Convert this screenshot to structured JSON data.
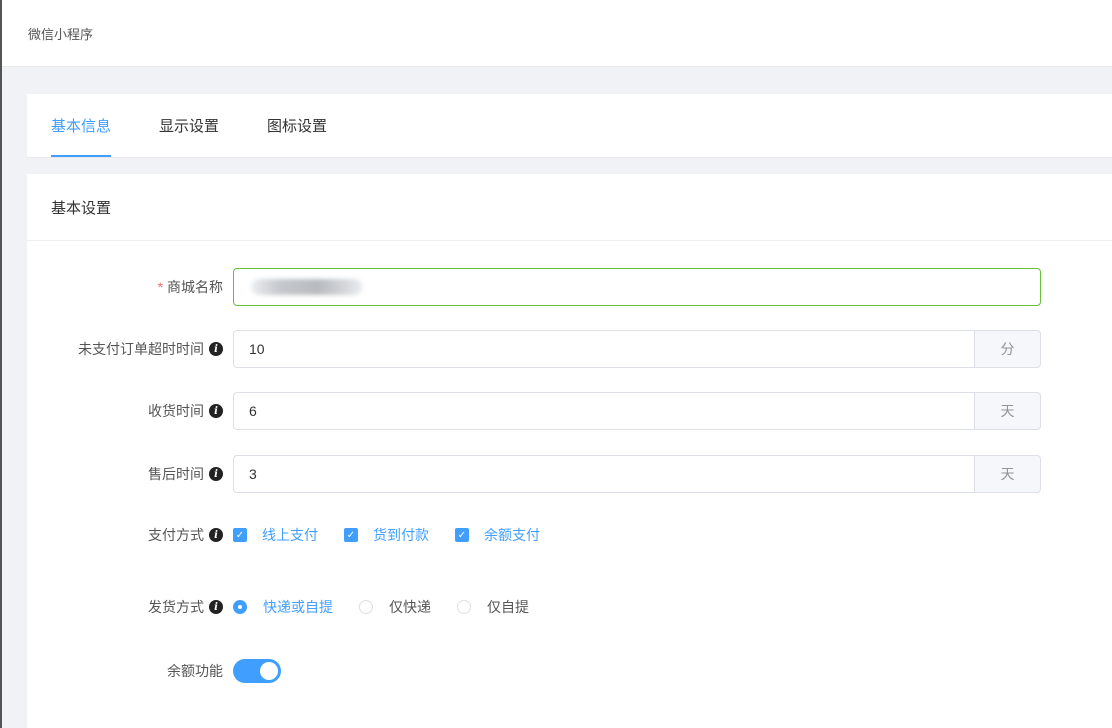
{
  "breadcrumb": {
    "title": "微信小程序"
  },
  "tabs": [
    {
      "label": "基本信息",
      "active": true
    },
    {
      "label": "显示设置",
      "active": false
    },
    {
      "label": "图标设置",
      "active": false
    }
  ],
  "section": {
    "title": "基本设置"
  },
  "form": {
    "store_name": {
      "label": "商城名称",
      "required_mark": "*",
      "value": ""
    },
    "unpaid_timeout": {
      "label": "未支付订单超时时间",
      "value": "10",
      "unit": "分"
    },
    "receive_time": {
      "label": "收货时间",
      "value": "6",
      "unit": "天"
    },
    "aftersale_time": {
      "label": "售后时间",
      "value": "3",
      "unit": "天"
    },
    "payment": {
      "label": "支付方式",
      "options": [
        {
          "label": "线上支付",
          "checked": true
        },
        {
          "label": "货到付款",
          "checked": true
        },
        {
          "label": "余额支付",
          "checked": true
        }
      ]
    },
    "delivery": {
      "label": "发货方式",
      "options": [
        {
          "label": "快递或自提",
          "checked": true
        },
        {
          "label": "仅快递",
          "checked": false
        },
        {
          "label": "仅自提",
          "checked": false
        }
      ]
    },
    "balance": {
      "label": "余额功能",
      "enabled": true
    }
  },
  "icons": {
    "info": "i",
    "check": "✓"
  },
  "colors": {
    "primary": "#409eff",
    "focus_border": "#67c23a",
    "required": "#f56c6c"
  }
}
